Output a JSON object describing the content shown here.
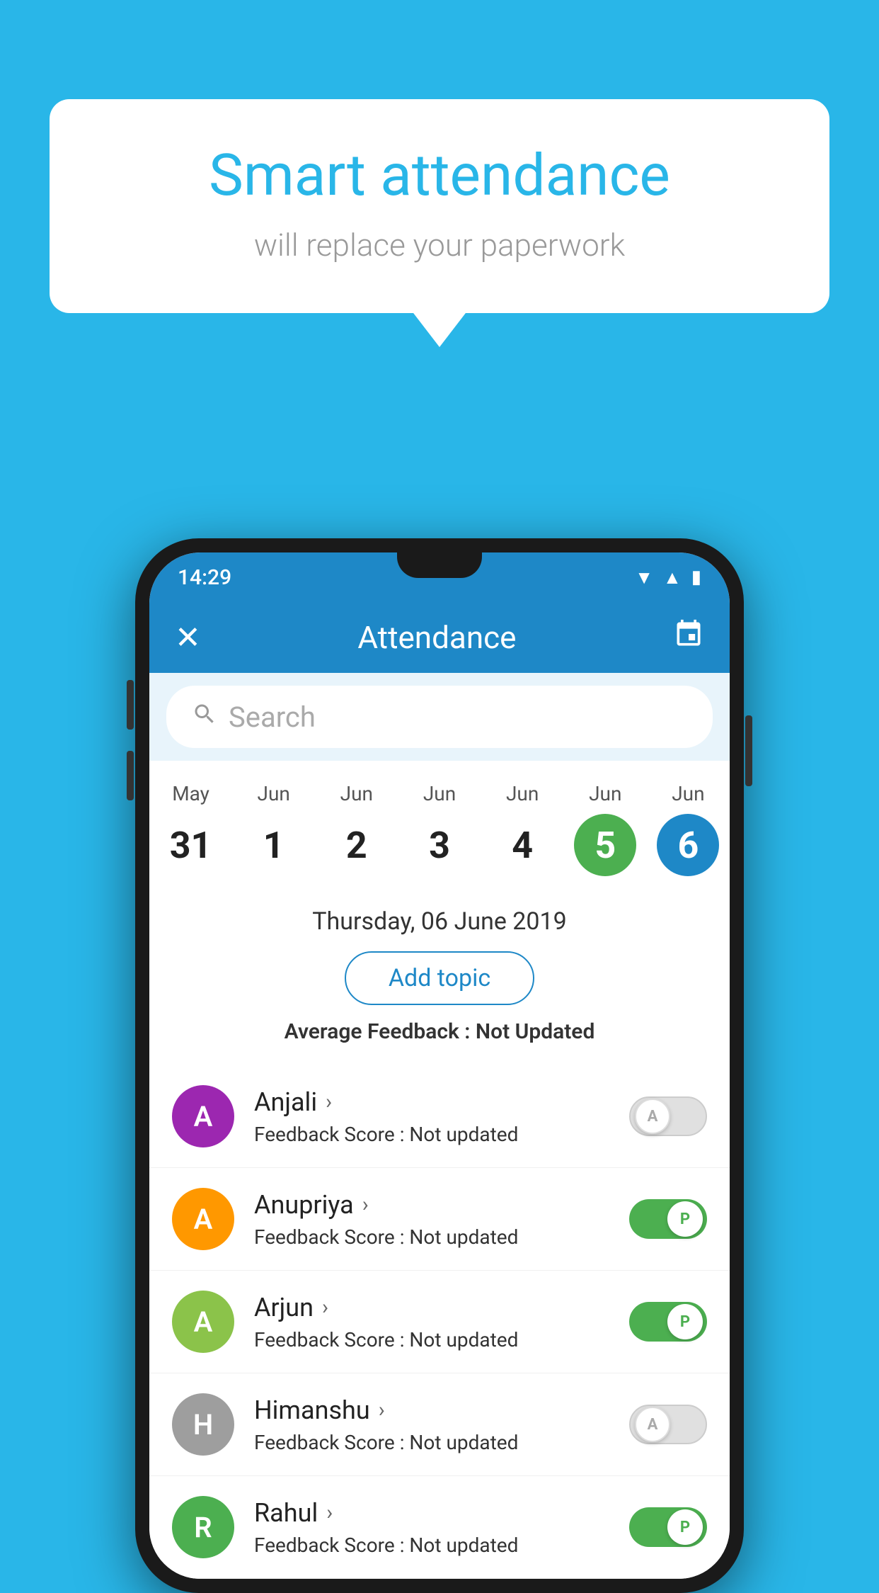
{
  "background_color": "#29b6e8",
  "speech_bubble": {
    "heading": "Smart attendance",
    "subtext": "will replace your paperwork"
  },
  "phone": {
    "status_bar": {
      "time": "14:29",
      "wifi_icon": "▼",
      "signal_icon": "▲",
      "battery_icon": "▮"
    },
    "app_bar": {
      "close_icon": "✕",
      "title": "Attendance",
      "calendar_icon": "📅"
    },
    "search": {
      "placeholder": "Search"
    },
    "calendar": {
      "days": [
        {
          "month": "May",
          "date": "31",
          "style": "normal"
        },
        {
          "month": "Jun",
          "date": "1",
          "style": "normal"
        },
        {
          "month": "Jun",
          "date": "2",
          "style": "normal"
        },
        {
          "month": "Jun",
          "date": "3",
          "style": "normal"
        },
        {
          "month": "Jun",
          "date": "4",
          "style": "normal"
        },
        {
          "month": "Jun",
          "date": "5",
          "style": "today"
        },
        {
          "month": "Jun",
          "date": "6",
          "style": "selected"
        }
      ]
    },
    "selected_date": "Thursday, 06 June 2019",
    "add_topic_label": "Add topic",
    "avg_feedback_label": "Average Feedback :",
    "avg_feedback_value": "Not Updated",
    "students": [
      {
        "name": "Anjali",
        "avatar_letter": "A",
        "avatar_color": "#9c27b0",
        "feedback": "Feedback Score :",
        "feedback_value": "Not updated",
        "attendance": "absent",
        "toggle_letter": "A"
      },
      {
        "name": "Anupriya",
        "avatar_letter": "A",
        "avatar_color": "#ff9800",
        "feedback": "Feedback Score :",
        "feedback_value": "Not updated",
        "attendance": "present",
        "toggle_letter": "P"
      },
      {
        "name": "Arjun",
        "avatar_letter": "A",
        "avatar_color": "#8bc34a",
        "feedback": "Feedback Score :",
        "feedback_value": "Not updated",
        "attendance": "present",
        "toggle_letter": "P"
      },
      {
        "name": "Himanshu",
        "avatar_letter": "H",
        "avatar_color": "#9e9e9e",
        "feedback": "Feedback Score :",
        "feedback_value": "Not updated",
        "attendance": "absent",
        "toggle_letter": "A"
      },
      {
        "name": "Rahul",
        "avatar_letter": "R",
        "avatar_color": "#4caf50",
        "feedback": "Feedback Score :",
        "feedback_value": "Not updated",
        "attendance": "present",
        "toggle_letter": "P"
      }
    ]
  }
}
